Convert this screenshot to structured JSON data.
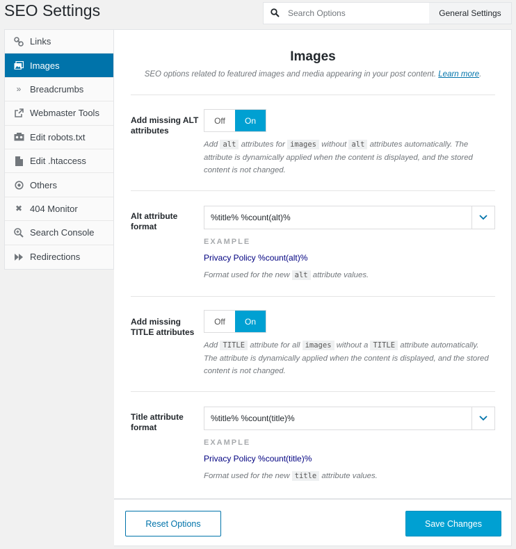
{
  "header": {
    "title": "SEO Settings",
    "search_placeholder": "Search Options",
    "general_button": "General Settings"
  },
  "sidebar": {
    "items": [
      {
        "label": "Links",
        "icon": "link-icon"
      },
      {
        "label": "Images",
        "icon": "images-icon",
        "active": true
      },
      {
        "label": "Breadcrumbs",
        "icon": "chevrons-right-icon"
      },
      {
        "label": "Webmaster Tools",
        "icon": "external-link-icon"
      },
      {
        "label": "Edit robots.txt",
        "icon": "robot-icon"
      },
      {
        "label": "Edit .htaccess",
        "icon": "file-icon"
      },
      {
        "label": "Others",
        "icon": "circle-dot-icon"
      },
      {
        "label": "404 Monitor",
        "icon": "close-icon"
      },
      {
        "label": "Search Console",
        "icon": "zoom-plus-icon"
      },
      {
        "label": "Redirections",
        "icon": "fast-forward-icon"
      }
    ]
  },
  "panel": {
    "title": "Images",
    "description": "SEO options related to featured images and media appearing in your post content.",
    "learn_more": "Learn more",
    "period": "."
  },
  "settings": {
    "alt_missing": {
      "label": "Add missing ALT attributes",
      "off": "Off",
      "on": "On",
      "help_1": "Add",
      "code_1": "alt",
      "help_2": "attributes for",
      "code_2": "images",
      "help_3": "without",
      "code_3": "alt",
      "help_4": "attributes automatically. The attribute is dynamically applied when the content is displayed, and the stored content is not changed."
    },
    "alt_format": {
      "label": "Alt attribute format",
      "value": "%title% %count(alt)%",
      "example_label": "EXAMPLE",
      "example_value": "Privacy Policy %count(alt)%",
      "help_1": "Format used for the new",
      "code": "alt",
      "help_2": "attribute values."
    },
    "title_missing": {
      "label": "Add missing TITLE attributes",
      "off": "Off",
      "on": "On",
      "help_1": "Add",
      "code_1": "TITLE",
      "help_2": "attribute for all",
      "code_2": "images",
      "help_3": "without a",
      "code_3": "TITLE",
      "help_4": "attribute automatically. The attribute is dynamically applied when the content is displayed, and the stored content is not changed."
    },
    "title_format": {
      "label": "Title attribute format",
      "value": "%title% %count(title)%",
      "example_label": "EXAMPLE",
      "example_value": "Privacy Policy %count(title)%",
      "help_1": "Format used for the new",
      "code": "title",
      "help_2": "attribute values."
    }
  },
  "footer": {
    "reset_label": "Reset Options",
    "save_label": "Save Changes"
  },
  "colors": {
    "accent": "#0073aa",
    "toggle_on": "#00a0d2"
  }
}
